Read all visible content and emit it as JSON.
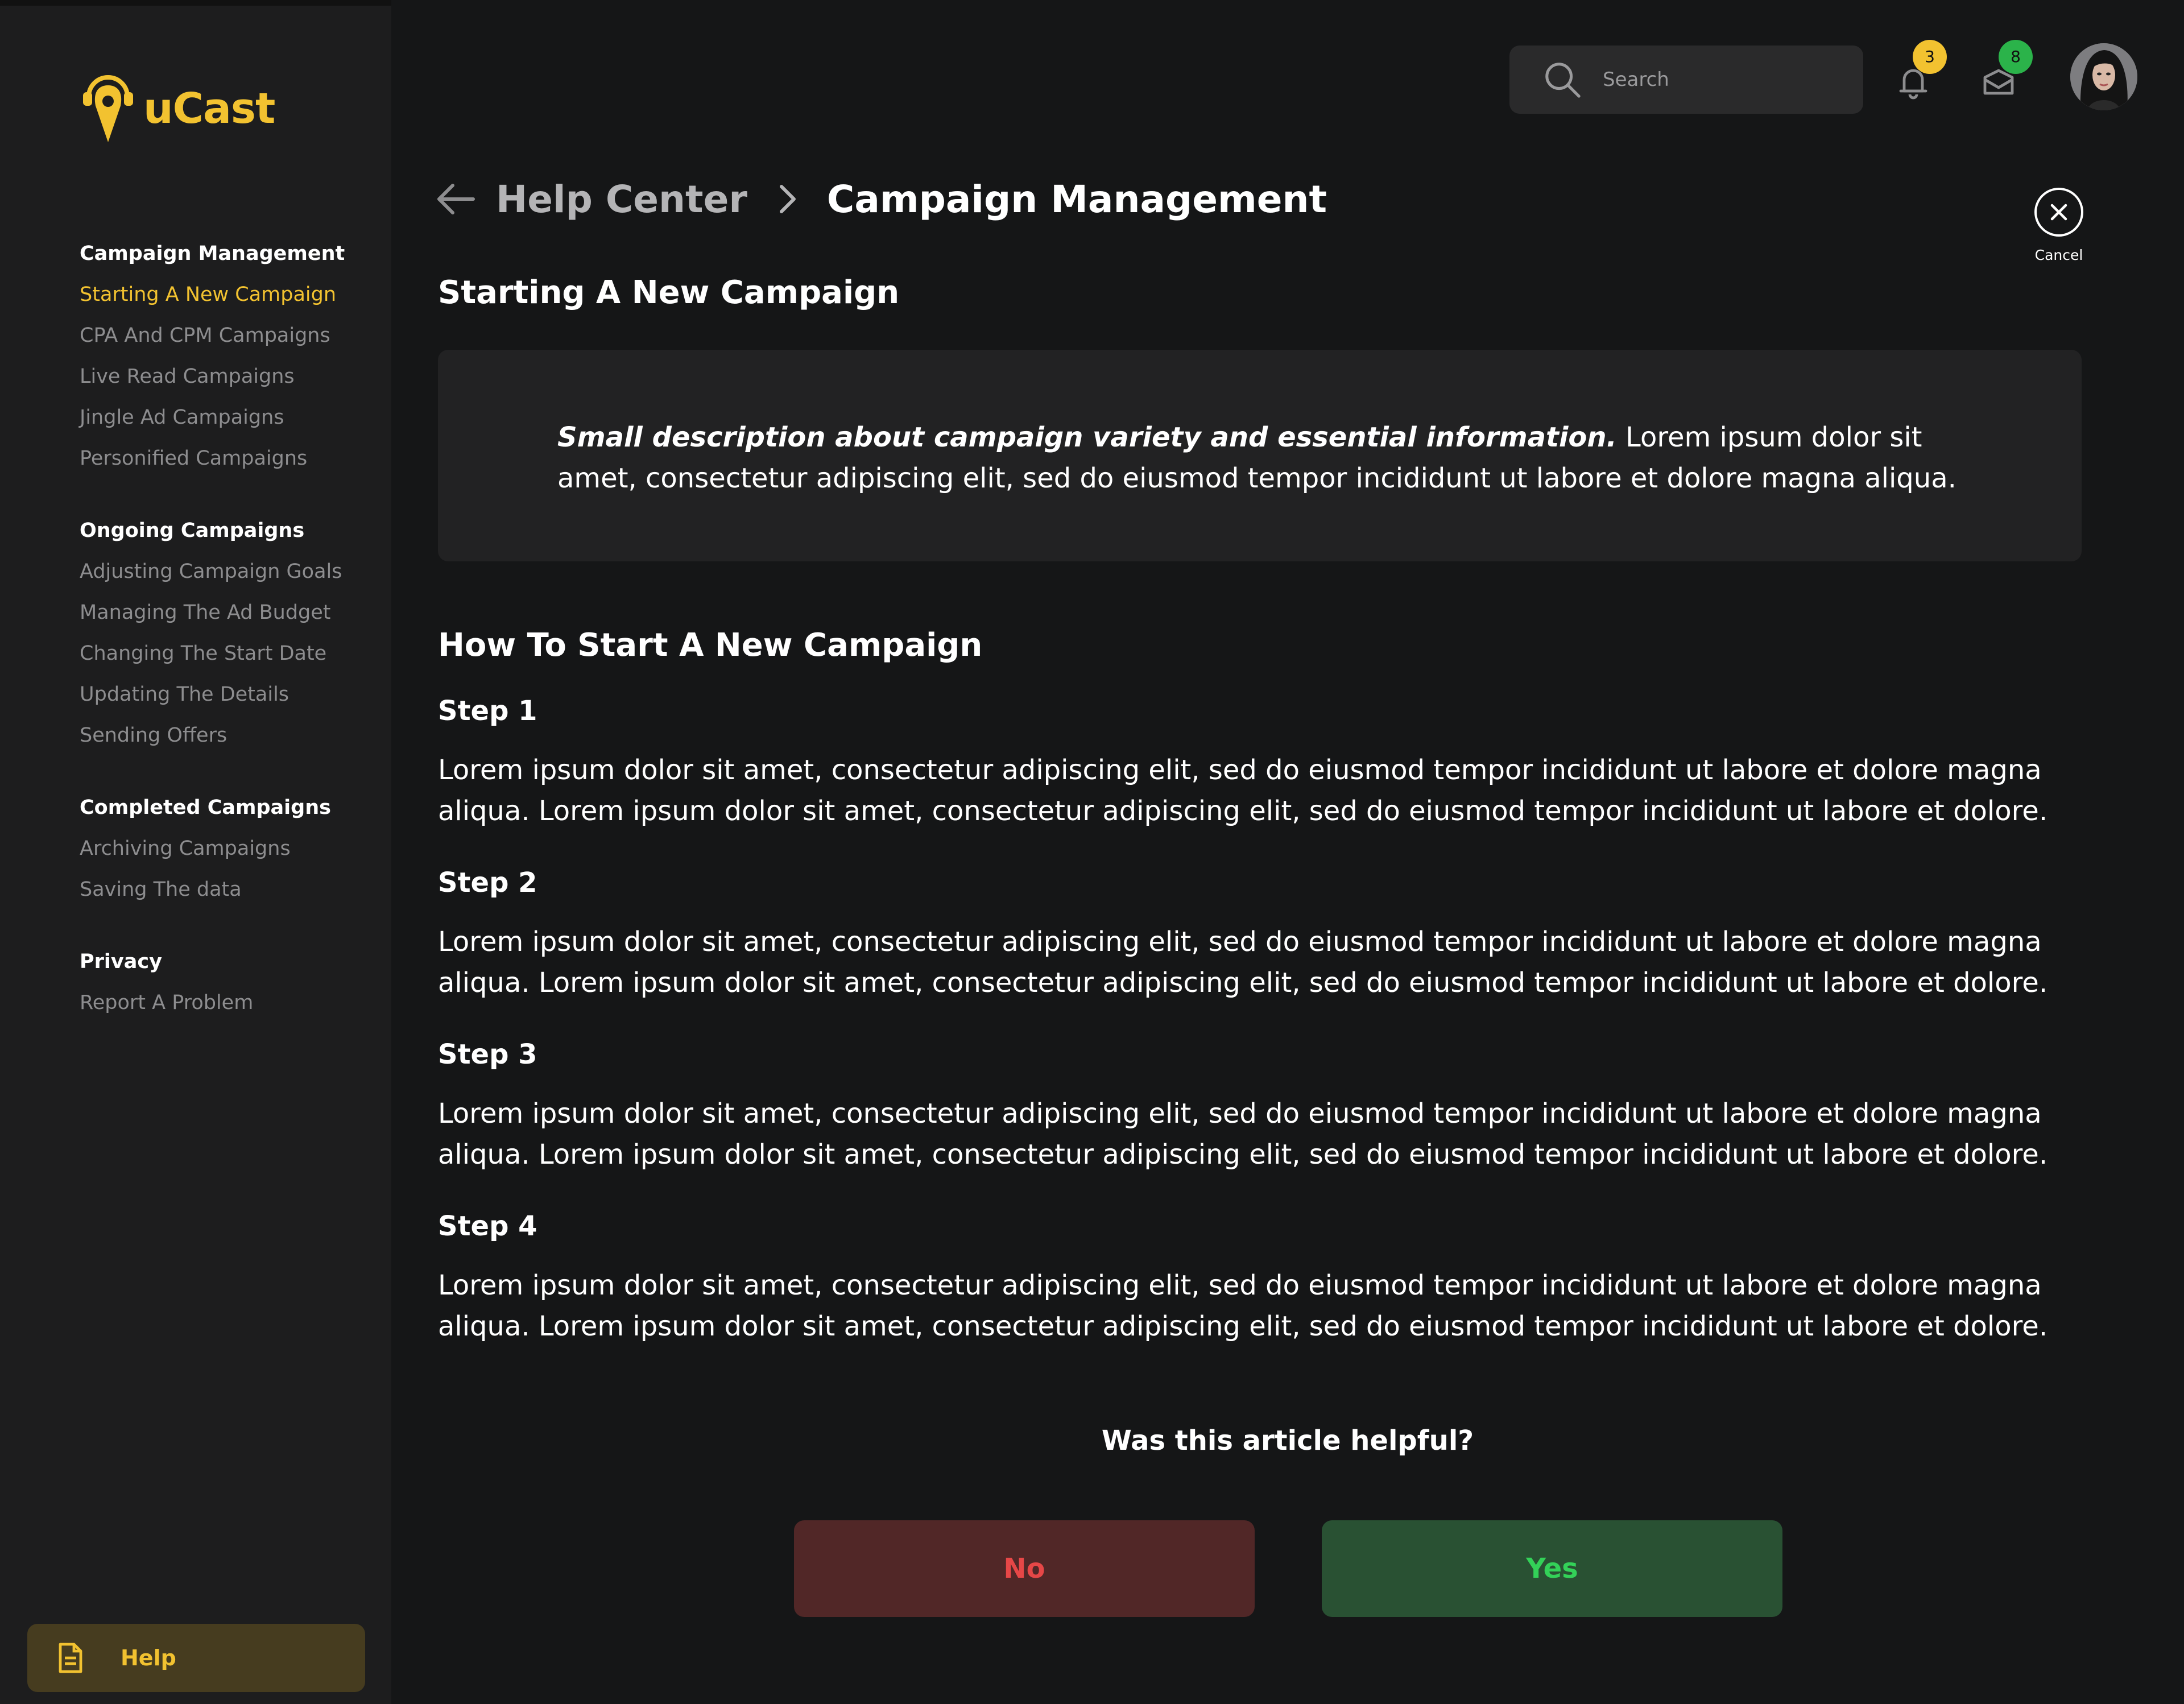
{
  "app": {
    "name": "uCast",
    "accent": "#f2c230"
  },
  "sidebar": {
    "groups": [
      {
        "title": "Campaign Management",
        "items": [
          "Starting A New Campaign",
          "CPA And CPM Campaigns",
          "Live Read Campaigns",
          "Jingle Ad Campaigns",
          "Personified Campaigns"
        ]
      },
      {
        "title": "Ongoing Campaigns",
        "items": [
          "Adjusting Campaign Goals",
          "Managing The Ad Budget",
          "Changing The Start Date",
          "Updating The Details",
          "Sending Offers"
        ]
      },
      {
        "title": "Completed Campaigns",
        "items": [
          "Archiving Campaigns",
          "Saving The data"
        ]
      },
      {
        "title": "Privacy",
        "items": [
          "Report A Problem"
        ]
      }
    ],
    "active_item": "Starting A New Campaign",
    "help_label": "Help"
  },
  "header": {
    "search_placeholder": "Search",
    "notifications_count": "3",
    "messages_count": "8",
    "notification_badge_color": "#f2c230",
    "message_badge_color": "#2bb34a"
  },
  "breadcrumb": {
    "home": "Help Center",
    "current": "Campaign Management"
  },
  "cancel_label": "Cancel",
  "article": {
    "title": "Starting A New Campaign",
    "description_strong": "Small description about campaign variety and  essential information.",
    "description_rest": " Lorem ipsum dolor sit amet, consectetur adipiscing elit, sed do eiusmod tempor incididunt ut labore et dolore magna aliqua.",
    "howto_title": "How To Start A New Campaign",
    "steps": [
      {
        "title": "Step 1",
        "body": " Lorem ipsum dolor sit amet, consectetur adipiscing elit, sed do eiusmod tempor incididunt ut labore et dolore magna aliqua. Lorem ipsum dolor sit amet, consectetur adipiscing elit, sed do eiusmod tempor incididunt ut labore et dolore."
      },
      {
        "title": "Step 2",
        "body": " Lorem ipsum dolor sit amet, consectetur adipiscing elit, sed do eiusmod tempor incididunt ut labore et dolore magna aliqua. Lorem ipsum dolor sit amet, consectetur adipiscing elit, sed do eiusmod tempor incididunt ut labore et dolore."
      },
      {
        "title": "Step 3",
        "body": " Lorem ipsum dolor sit amet, consectetur adipiscing elit, sed do eiusmod tempor incididunt ut labore et dolore magna aliqua. Lorem ipsum dolor sit amet, consectetur adipiscing elit, sed do eiusmod tempor incididunt ut labore et dolore."
      },
      {
        "title": "Step 4",
        "body": " Lorem ipsum dolor sit amet, consectetur adipiscing elit, sed do eiusmod tempor incididunt ut labore et dolore magna aliqua. Lorem ipsum dolor sit amet, consectetur adipiscing elit, sed do eiusmod tempor incididunt ut labore et dolore."
      }
    ]
  },
  "feedback": {
    "question": "Was this article helpful?",
    "no_label": "No",
    "yes_label": "Yes"
  }
}
